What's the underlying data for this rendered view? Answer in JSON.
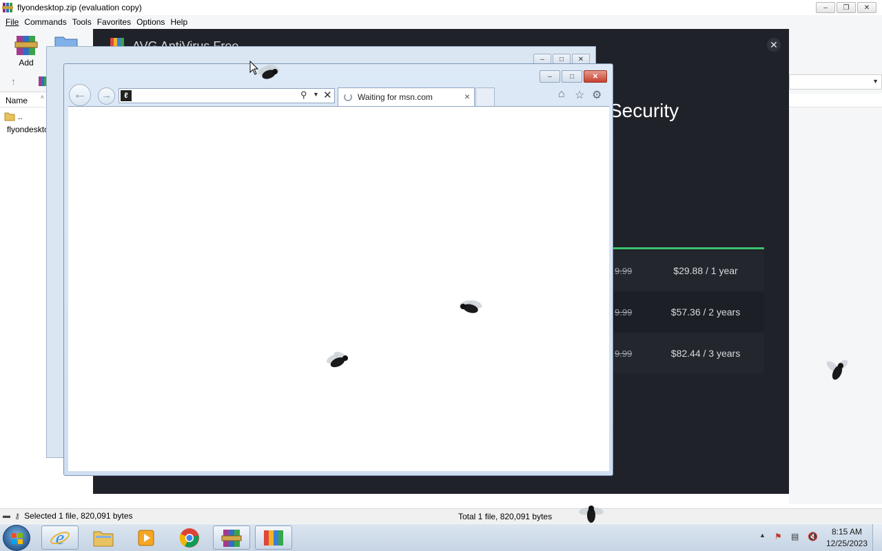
{
  "winrar": {
    "title": "flyondesktop.zip (evaluation copy)",
    "menu": [
      "File",
      "Commands",
      "Tools",
      "Favorites",
      "Options",
      "Help"
    ],
    "add_label": "Add",
    "column_name": "Name",
    "files": [
      {
        "name": ".."
      },
      {
        "name": "flyondesktop"
      }
    ],
    "status_left": "Selected 1 file, 820,091 bytes",
    "status_right": "Total 1 file, 820,091 bytes"
  },
  "avg": {
    "title": "AVG AntiVirus Free",
    "heading": "Security",
    "accent_color": "#3bc46f",
    "prices": [
      {
        "old": "9.99",
        "new": "$29.88 / 1 year"
      },
      {
        "old": "9.99",
        "new": "$57.36 / 2 years"
      },
      {
        "old": "9.99",
        "new": "$82.44 / 3 years"
      }
    ]
  },
  "ie": {
    "address_value": "",
    "tab_label": "Waiting for msn.com",
    "icons": [
      "back-arrow-icon",
      "forward-arrow-icon",
      "search-icon",
      "stop-icon",
      "home-icon",
      "favorites-star-icon",
      "gear-icon"
    ]
  },
  "taskbar": {
    "time": "8:15 AM",
    "date": "12/25/2023",
    "apps": [
      "internet-explorer-icon",
      "file-explorer-icon",
      "media-player-icon",
      "chrome-icon",
      "winrar-icon",
      "avg-icon"
    ]
  }
}
